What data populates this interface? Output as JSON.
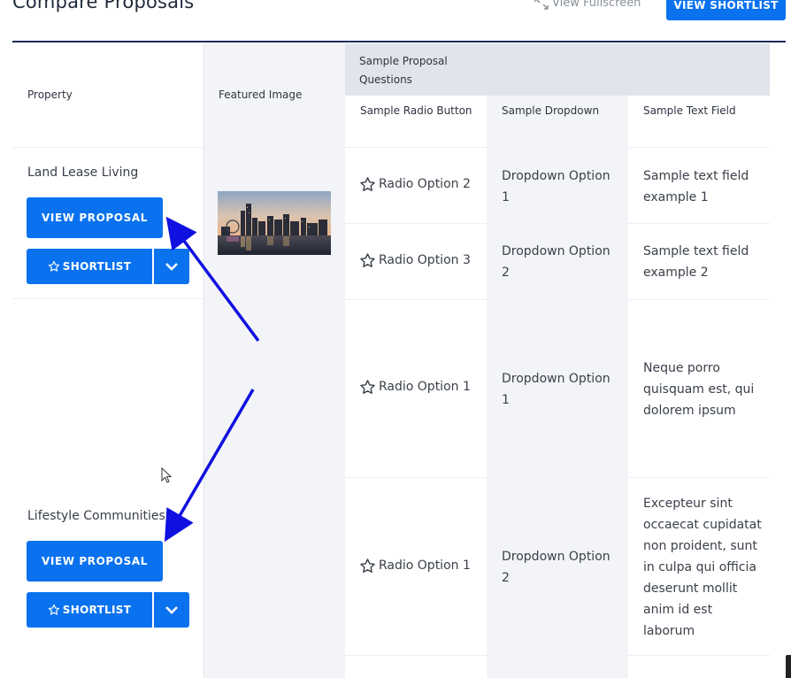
{
  "header": {
    "title": "Compare Proposals",
    "fullscreen_label": "View Fullscreen",
    "shortlist_label": "VIEW SHORTLIST"
  },
  "table": {
    "col_property": "Property",
    "col_featured_image": "Featured Image",
    "group_header": "Sample Proposal Questions",
    "col_radio": "Sample Radio Button",
    "col_dropdown": "Sample Dropdown",
    "col_text": "Sample Text Field"
  },
  "properties": [
    {
      "name": "Land Lease Living",
      "view_label": "VIEW PROPOSAL",
      "shortlist_label": "SHORTLIST"
    },
    {
      "name": "Lifestyle Communities",
      "view_label": "VIEW PROPOSAL",
      "shortlist_label": "SHORTLIST"
    }
  ],
  "rows": [
    {
      "radio": "Radio Option 2",
      "dropdown": "Dropdown Option 1",
      "text": "Sample text field example 1"
    },
    {
      "radio": "Radio Option 3",
      "dropdown": "Dropdown Option 2",
      "text": "Sample text field example 2"
    },
    {
      "radio": "Radio Option 1",
      "dropdown": "Dropdown Option 1",
      "text": "Neque porro quisquam est, qui dolorem ipsum"
    },
    {
      "radio": "Radio Option 1",
      "dropdown": "Dropdown Option 2",
      "text": "Excepteur sint occaecat cupidatat non proident, sunt in culpa qui officia deserunt mollit anim id est laborum"
    }
  ],
  "colors": {
    "accent": "#0a72ef",
    "header_rule": "#1d2c5e",
    "annotation_arrow": "#1010e0"
  }
}
